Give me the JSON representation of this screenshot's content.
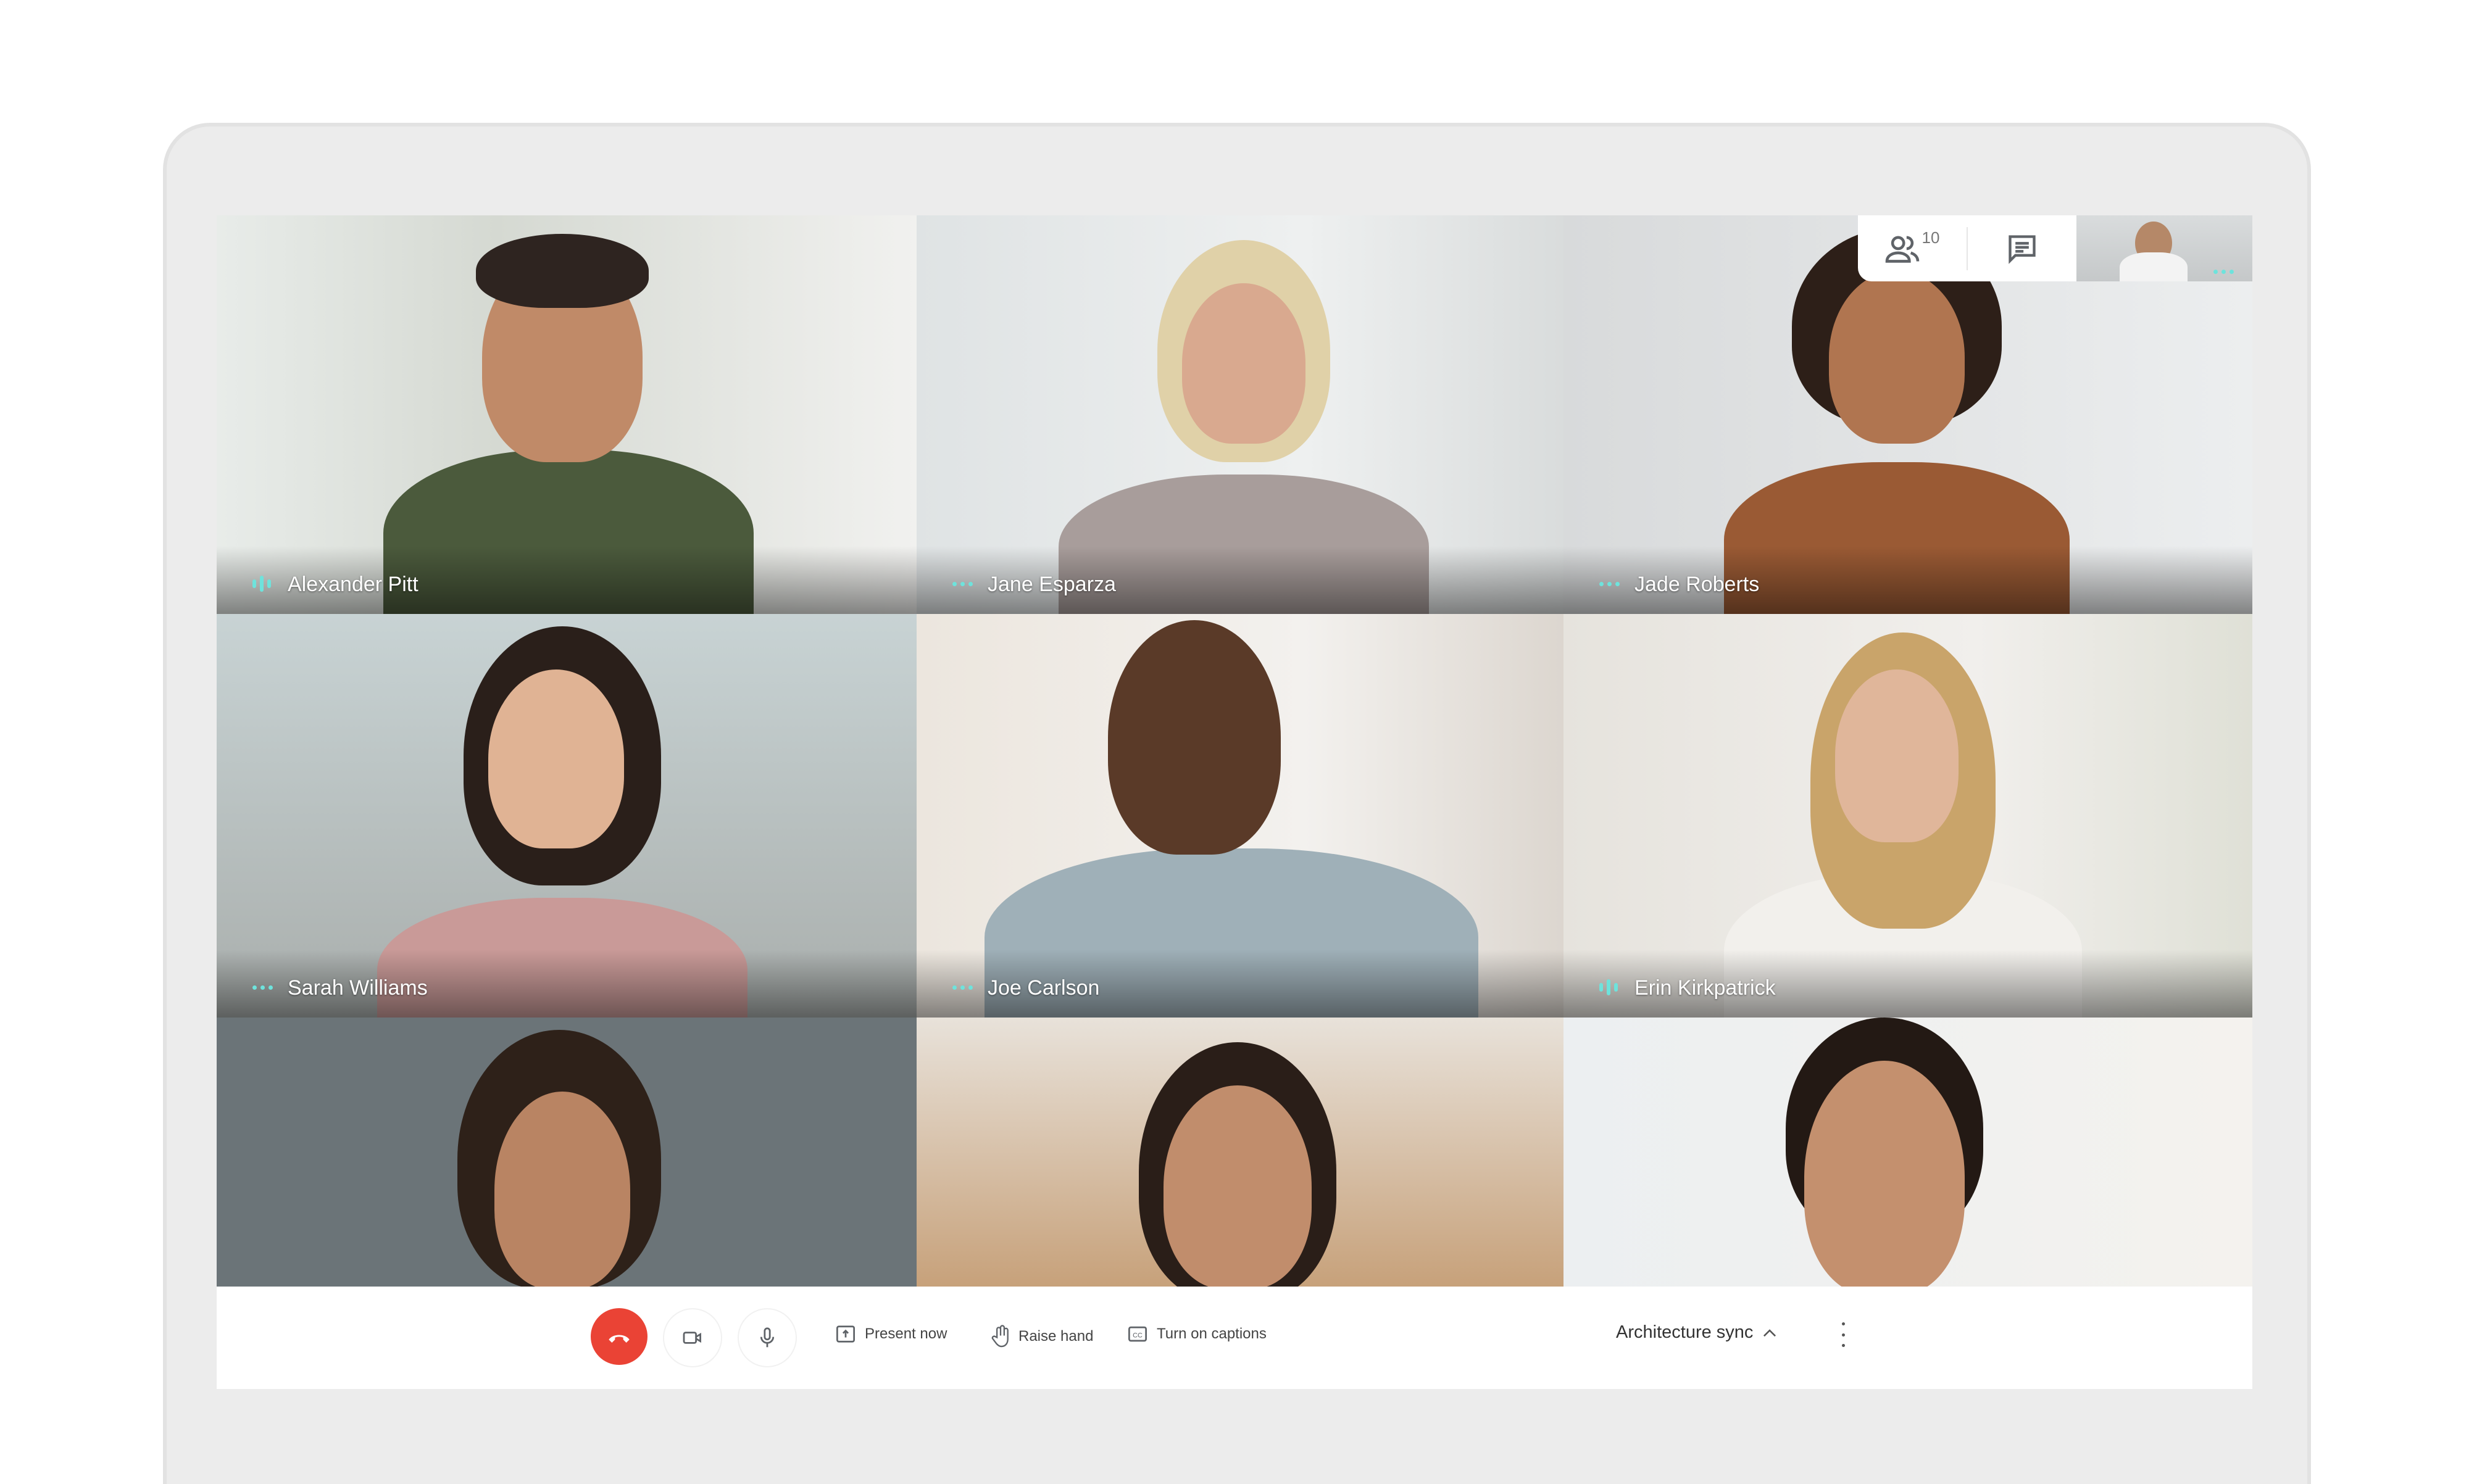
{
  "participants_count": "10",
  "tiles": [
    {
      "name": "Alexander Pitt",
      "indicator": "speaking"
    },
    {
      "name": "Jane Esparza",
      "indicator": "dots"
    },
    {
      "name": "Jade Roberts",
      "indicator": "dots"
    },
    {
      "name": "Sarah Williams",
      "indicator": "dots"
    },
    {
      "name": "Joe Carlson",
      "indicator": "dots"
    },
    {
      "name": "Erin Kirkpatrick",
      "indicator": "speaking"
    },
    {
      "name": "",
      "indicator": ""
    },
    {
      "name": "",
      "indicator": ""
    },
    {
      "name": "",
      "indicator": ""
    }
  ],
  "toolbar": {
    "present_label": "Present now",
    "raise_hand_label": "Raise hand",
    "captions_label": "Turn on captions",
    "meeting_name": "Architecture sync"
  },
  "colors": {
    "hangup": "#ea4335",
    "indicator": "#6ee3dc"
  }
}
